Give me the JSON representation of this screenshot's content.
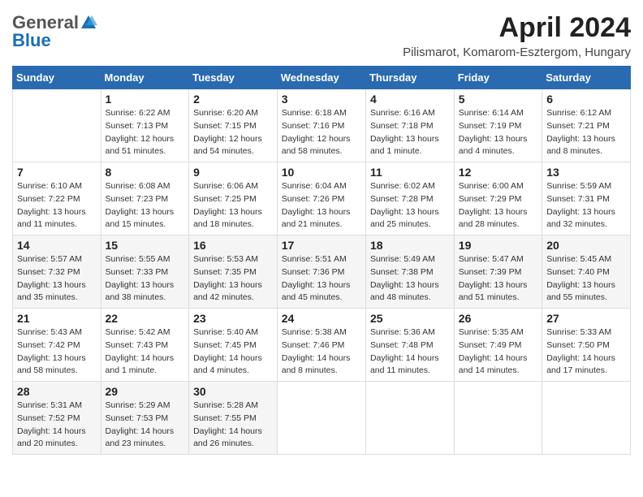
{
  "header": {
    "logo_general": "General",
    "logo_blue": "Blue",
    "month_title": "April 2024",
    "location": "Pilismarot, Komarom-Esztergom, Hungary"
  },
  "weekdays": [
    "Sunday",
    "Monday",
    "Tuesday",
    "Wednesday",
    "Thursday",
    "Friday",
    "Saturday"
  ],
  "weeks": [
    [
      {
        "day": "",
        "sunrise": "",
        "sunset": "",
        "daylight": ""
      },
      {
        "day": "1",
        "sunrise": "Sunrise: 6:22 AM",
        "sunset": "Sunset: 7:13 PM",
        "daylight": "Daylight: 12 hours and 51 minutes."
      },
      {
        "day": "2",
        "sunrise": "Sunrise: 6:20 AM",
        "sunset": "Sunset: 7:15 PM",
        "daylight": "Daylight: 12 hours and 54 minutes."
      },
      {
        "day": "3",
        "sunrise": "Sunrise: 6:18 AM",
        "sunset": "Sunset: 7:16 PM",
        "daylight": "Daylight: 12 hours and 58 minutes."
      },
      {
        "day": "4",
        "sunrise": "Sunrise: 6:16 AM",
        "sunset": "Sunset: 7:18 PM",
        "daylight": "Daylight: 13 hours and 1 minute."
      },
      {
        "day": "5",
        "sunrise": "Sunrise: 6:14 AM",
        "sunset": "Sunset: 7:19 PM",
        "daylight": "Daylight: 13 hours and 4 minutes."
      },
      {
        "day": "6",
        "sunrise": "Sunrise: 6:12 AM",
        "sunset": "Sunset: 7:21 PM",
        "daylight": "Daylight: 13 hours and 8 minutes."
      }
    ],
    [
      {
        "day": "7",
        "sunrise": "Sunrise: 6:10 AM",
        "sunset": "Sunset: 7:22 PM",
        "daylight": "Daylight: 13 hours and 11 minutes."
      },
      {
        "day": "8",
        "sunrise": "Sunrise: 6:08 AM",
        "sunset": "Sunset: 7:23 PM",
        "daylight": "Daylight: 13 hours and 15 minutes."
      },
      {
        "day": "9",
        "sunrise": "Sunrise: 6:06 AM",
        "sunset": "Sunset: 7:25 PM",
        "daylight": "Daylight: 13 hours and 18 minutes."
      },
      {
        "day": "10",
        "sunrise": "Sunrise: 6:04 AM",
        "sunset": "Sunset: 7:26 PM",
        "daylight": "Daylight: 13 hours and 21 minutes."
      },
      {
        "day": "11",
        "sunrise": "Sunrise: 6:02 AM",
        "sunset": "Sunset: 7:28 PM",
        "daylight": "Daylight: 13 hours and 25 minutes."
      },
      {
        "day": "12",
        "sunrise": "Sunrise: 6:00 AM",
        "sunset": "Sunset: 7:29 PM",
        "daylight": "Daylight: 13 hours and 28 minutes."
      },
      {
        "day": "13",
        "sunrise": "Sunrise: 5:59 AM",
        "sunset": "Sunset: 7:31 PM",
        "daylight": "Daylight: 13 hours and 32 minutes."
      }
    ],
    [
      {
        "day": "14",
        "sunrise": "Sunrise: 5:57 AM",
        "sunset": "Sunset: 7:32 PM",
        "daylight": "Daylight: 13 hours and 35 minutes."
      },
      {
        "day": "15",
        "sunrise": "Sunrise: 5:55 AM",
        "sunset": "Sunset: 7:33 PM",
        "daylight": "Daylight: 13 hours and 38 minutes."
      },
      {
        "day": "16",
        "sunrise": "Sunrise: 5:53 AM",
        "sunset": "Sunset: 7:35 PM",
        "daylight": "Daylight: 13 hours and 42 minutes."
      },
      {
        "day": "17",
        "sunrise": "Sunrise: 5:51 AM",
        "sunset": "Sunset: 7:36 PM",
        "daylight": "Daylight: 13 hours and 45 minutes."
      },
      {
        "day": "18",
        "sunrise": "Sunrise: 5:49 AM",
        "sunset": "Sunset: 7:38 PM",
        "daylight": "Daylight: 13 hours and 48 minutes."
      },
      {
        "day": "19",
        "sunrise": "Sunrise: 5:47 AM",
        "sunset": "Sunset: 7:39 PM",
        "daylight": "Daylight: 13 hours and 51 minutes."
      },
      {
        "day": "20",
        "sunrise": "Sunrise: 5:45 AM",
        "sunset": "Sunset: 7:40 PM",
        "daylight": "Daylight: 13 hours and 55 minutes."
      }
    ],
    [
      {
        "day": "21",
        "sunrise": "Sunrise: 5:43 AM",
        "sunset": "Sunset: 7:42 PM",
        "daylight": "Daylight: 13 hours and 58 minutes."
      },
      {
        "day": "22",
        "sunrise": "Sunrise: 5:42 AM",
        "sunset": "Sunset: 7:43 PM",
        "daylight": "Daylight: 14 hours and 1 minute."
      },
      {
        "day": "23",
        "sunrise": "Sunrise: 5:40 AM",
        "sunset": "Sunset: 7:45 PM",
        "daylight": "Daylight: 14 hours and 4 minutes."
      },
      {
        "day": "24",
        "sunrise": "Sunrise: 5:38 AM",
        "sunset": "Sunset: 7:46 PM",
        "daylight": "Daylight: 14 hours and 8 minutes."
      },
      {
        "day": "25",
        "sunrise": "Sunrise: 5:36 AM",
        "sunset": "Sunset: 7:48 PM",
        "daylight": "Daylight: 14 hours and 11 minutes."
      },
      {
        "day": "26",
        "sunrise": "Sunrise: 5:35 AM",
        "sunset": "Sunset: 7:49 PM",
        "daylight": "Daylight: 14 hours and 14 minutes."
      },
      {
        "day": "27",
        "sunrise": "Sunrise: 5:33 AM",
        "sunset": "Sunset: 7:50 PM",
        "daylight": "Daylight: 14 hours and 17 minutes."
      }
    ],
    [
      {
        "day": "28",
        "sunrise": "Sunrise: 5:31 AM",
        "sunset": "Sunset: 7:52 PM",
        "daylight": "Daylight: 14 hours and 20 minutes."
      },
      {
        "day": "29",
        "sunrise": "Sunrise: 5:29 AM",
        "sunset": "Sunset: 7:53 PM",
        "daylight": "Daylight: 14 hours and 23 minutes."
      },
      {
        "day": "30",
        "sunrise": "Sunrise: 5:28 AM",
        "sunset": "Sunset: 7:55 PM",
        "daylight": "Daylight: 14 hours and 26 minutes."
      },
      {
        "day": "",
        "sunrise": "",
        "sunset": "",
        "daylight": ""
      },
      {
        "day": "",
        "sunrise": "",
        "sunset": "",
        "daylight": ""
      },
      {
        "day": "",
        "sunrise": "",
        "sunset": "",
        "daylight": ""
      },
      {
        "day": "",
        "sunrise": "",
        "sunset": "",
        "daylight": ""
      }
    ]
  ]
}
